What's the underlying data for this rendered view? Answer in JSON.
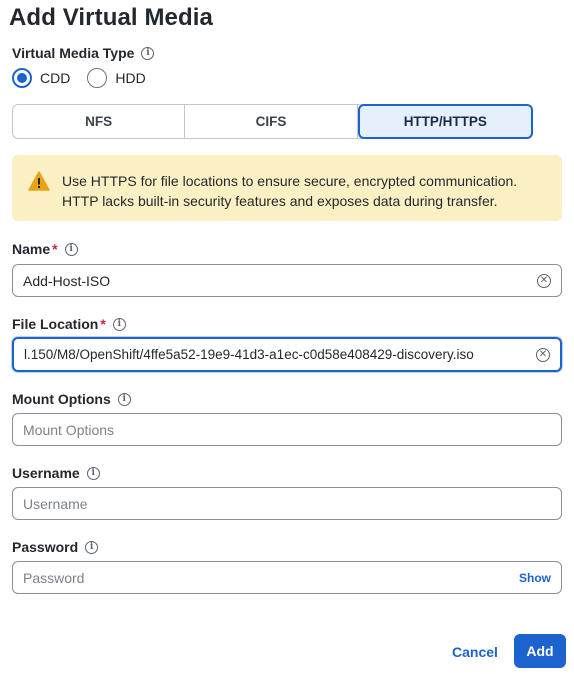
{
  "dialog": {
    "title": "Add Virtual Media"
  },
  "media_type": {
    "label": "Virtual Media Type",
    "options": [
      {
        "label": "CDD",
        "checked": true
      },
      {
        "label": "HDD",
        "checked": false
      }
    ]
  },
  "protocol_tabs": [
    {
      "label": "NFS",
      "active": false
    },
    {
      "label": "CIFS",
      "active": false
    },
    {
      "label": "HTTP/HTTPS",
      "active": true
    }
  ],
  "alert": {
    "icon": "warning-icon",
    "color": "#fbf0c3",
    "line1": "Use HTTPS for file locations to ensure secure, encrypted communication.",
    "line2": "HTTP lacks built-in security features and exposes data during transfer."
  },
  "fields": {
    "name": {
      "label": "Name",
      "required_mark": "*",
      "value": "Add-Host-ISO"
    },
    "file_location": {
      "label": "File Location",
      "required_mark": "*",
      "value": "l.150/M8/OpenShift/4ffe5a52-19e9-41d3-a1ec-c0d58e408429-discovery.iso"
    },
    "mount_options": {
      "label": "Mount Options",
      "placeholder": "Mount Options"
    },
    "username": {
      "label": "Username",
      "placeholder": "Username"
    },
    "password": {
      "label": "Password",
      "placeholder": "Password",
      "show_label": "Show"
    }
  },
  "actions": {
    "cancel_label": "Cancel",
    "add_label": "Add"
  },
  "colors": {
    "accent": "#1d63d0",
    "required": "#d0233a",
    "warning": "#e8a317"
  }
}
